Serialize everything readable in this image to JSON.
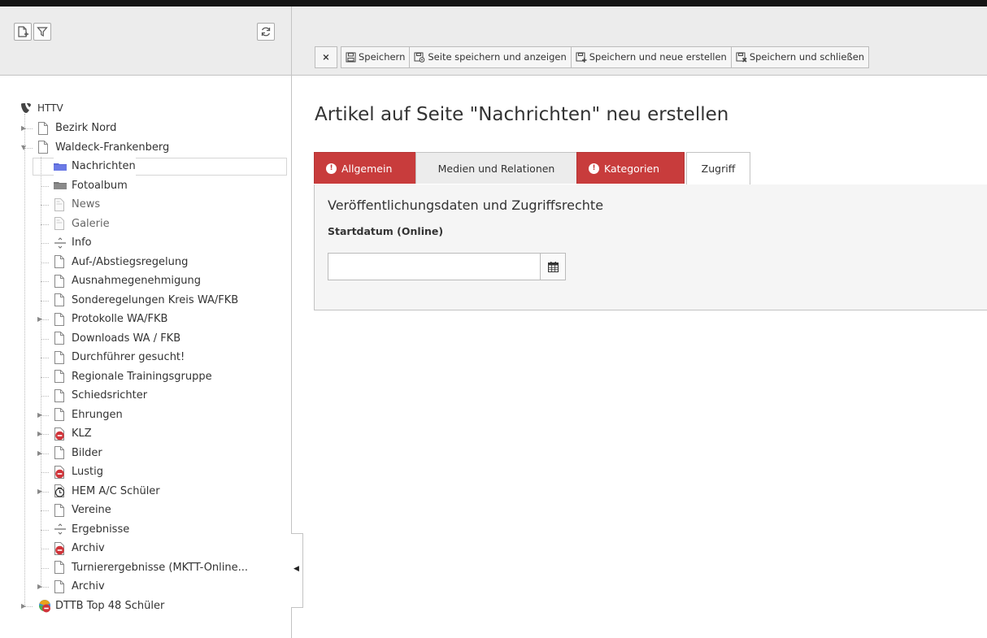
{
  "tree_toolbar": {
    "icons": [
      "new-page-icon",
      "filter-icon",
      "refresh-icon"
    ]
  },
  "tree": {
    "root_label": "HTTV",
    "items": [
      {
        "label": "Bezirk Nord",
        "level": 1,
        "icon": "page-icon",
        "expander": "collapsed"
      },
      {
        "label": "Waldeck-Frankenberg",
        "level": 1,
        "icon": "page-icon",
        "expander": "expanded"
      },
      {
        "label": "Nachrichten",
        "level": 2,
        "icon": "folder-blue-icon",
        "selected": true
      },
      {
        "label": "Fotoalbum",
        "level": 2,
        "icon": "folder-gray-icon"
      },
      {
        "label": "News",
        "level": 2,
        "icon": "page-muted-icon",
        "muted": true
      },
      {
        "label": "Galerie",
        "level": 2,
        "icon": "page-muted-icon",
        "muted": true
      },
      {
        "label": "Info",
        "level": 2,
        "icon": "separator-icon"
      },
      {
        "label": "Auf-/Abstiegsregelung",
        "level": 2,
        "icon": "page-icon"
      },
      {
        "label": "Ausnahmegenehmigung",
        "level": 2,
        "icon": "page-icon"
      },
      {
        "label": "Sonderegelungen Kreis WA/FKB",
        "level": 2,
        "icon": "page-icon"
      },
      {
        "label": "Protokolle WA/FKB",
        "level": 2,
        "icon": "page-icon",
        "expander": "collapsed"
      },
      {
        "label": "Downloads WA / FKB",
        "level": 2,
        "icon": "page-icon"
      },
      {
        "label": "Durchführer gesucht!",
        "level": 2,
        "icon": "page-icon"
      },
      {
        "label": "Regionale Trainingsgruppe",
        "level": 2,
        "icon": "page-icon"
      },
      {
        "label": "Schiedsrichter",
        "level": 2,
        "icon": "page-icon"
      },
      {
        "label": "Ehrungen",
        "level": 2,
        "icon": "page-icon",
        "expander": "collapsed"
      },
      {
        "label": "KLZ",
        "level": 2,
        "icon": "page-hidden-icon",
        "expander": "collapsed"
      },
      {
        "label": "Bilder",
        "level": 2,
        "icon": "page-icon",
        "expander": "collapsed"
      },
      {
        "label": "Lustig",
        "level": 2,
        "icon": "page-hidden-icon"
      },
      {
        "label": "HEM A/C Schüler",
        "level": 2,
        "icon": "page-timed-icon",
        "expander": "collapsed"
      },
      {
        "label": "Vereine",
        "level": 2,
        "icon": "page-icon"
      },
      {
        "label": "Ergebnisse",
        "level": 2,
        "icon": "separator-icon"
      },
      {
        "label": "Archiv",
        "level": 2,
        "icon": "page-hidden-icon"
      },
      {
        "label": "Turnierergebnisse (MKTT-Online...",
        "level": 2,
        "icon": "page-icon"
      },
      {
        "label": "Archiv",
        "level": 2,
        "icon": "page-icon",
        "expander": "collapsed"
      },
      {
        "label": "DTTB Top 48 Schüler",
        "level": 1,
        "icon": "external-hidden-icon",
        "expander": "collapsed"
      }
    ]
  },
  "docheader": {
    "close_label": "×",
    "buttons": [
      {
        "label": "Speichern",
        "icon": "save-icon"
      },
      {
        "label": "Seite speichern und anzeigen",
        "icon": "save-view-icon"
      },
      {
        "label": "Speichern und neue erstellen",
        "icon": "save-new-icon"
      },
      {
        "label": "Speichern und schließen",
        "icon": "save-close-icon"
      }
    ]
  },
  "main": {
    "title": "Artikel auf Seite \"Nachrichten\" neu erstellen",
    "tabs": [
      {
        "label": "Allgemein",
        "error": true
      },
      {
        "label": "Medien und Relationen",
        "error": false
      },
      {
        "label": "Kategorien",
        "error": true
      },
      {
        "label": "Zugriff",
        "error": false,
        "active": true
      }
    ],
    "error_badge": "!",
    "section_title": "Veröffentlichungsdaten und Zugriffsrechte",
    "field_label": "Startdatum (Online)",
    "field_value": ""
  },
  "colors": {
    "error_tab": "#c83c3c",
    "panel_bg": "#ececec",
    "topbar": "#151515"
  }
}
